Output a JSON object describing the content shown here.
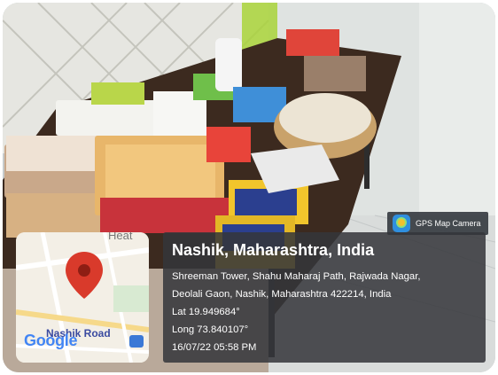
{
  "badge": {
    "label": "GPS Map Camera",
    "icon": "gps-map-camera-app-icon"
  },
  "map": {
    "place_label": "Nashik Road",
    "logo_text": "Google",
    "partial_label": "Heat",
    "pin_color": "#d93a2b"
  },
  "info": {
    "title": "Nashik, Maharashtra, India",
    "address_line1": "Shreeman Tower, Shahu Maharaj Path, Rajwada Nagar,",
    "address_line2": "Deolali Gaon, Nashik, Maharashtra 422214, India",
    "latitude": "Lat 19.949684°",
    "longitude": "Long 73.840107°",
    "timestamp": "16/07/22 05:58 PM"
  }
}
